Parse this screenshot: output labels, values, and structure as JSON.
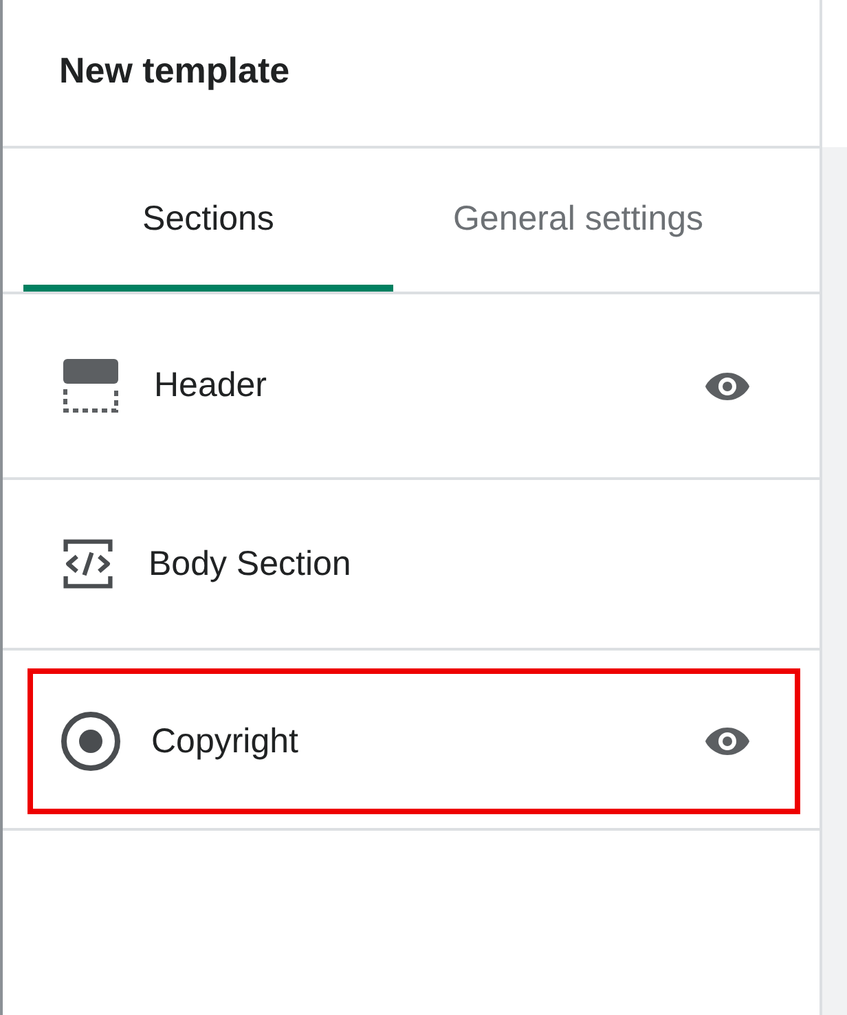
{
  "panel": {
    "title": "New template"
  },
  "tabs": [
    {
      "label": "Sections",
      "selected": true
    },
    {
      "label": "General settings",
      "selected": false
    }
  ],
  "sections": [
    {
      "kind": "header",
      "label": "Header",
      "visible": true,
      "highlighted": false
    },
    {
      "kind": "body",
      "label": "Body Section",
      "visible": false,
      "highlighted": false
    },
    {
      "kind": "footer",
      "label": "Copyright",
      "visible": true,
      "highlighted": true
    }
  ]
}
